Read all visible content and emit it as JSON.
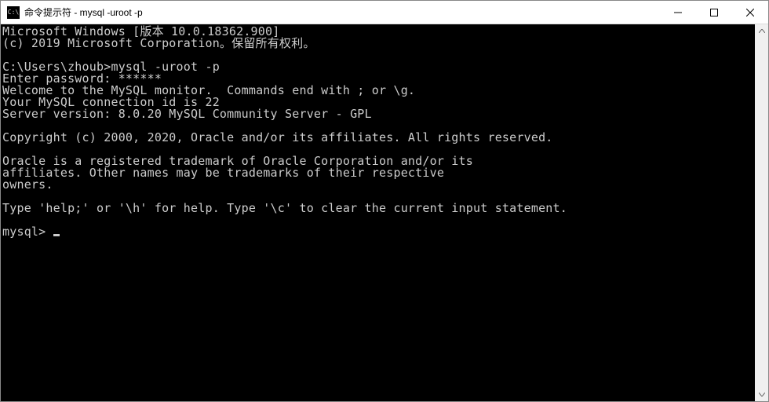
{
  "window": {
    "title": "命令提示符 - mysql  -uroot -p",
    "icon_label": "C:\\"
  },
  "terminal": {
    "line1": "Microsoft Windows [版本 10.0.18362.900]",
    "line2": "(c) 2019 Microsoft Corporation。保留所有权利。",
    "blank1": "",
    "line3": "C:\\Users\\zhoub>mysql -uroot -p",
    "line4": "Enter password: ******",
    "line5": "Welcome to the MySQL monitor.  Commands end with ; or \\g.",
    "line6": "Your MySQL connection id is 22",
    "line7": "Server version: 8.0.20 MySQL Community Server - GPL",
    "blank2": "",
    "line8": "Copyright (c) 2000, 2020, Oracle and/or its affiliates. All rights reserved.",
    "blank3": "",
    "line9": "Oracle is a registered trademark of Oracle Corporation and/or its",
    "line10": "affiliates. Other names may be trademarks of their respective",
    "line11": "owners.",
    "blank4": "",
    "line12": "Type 'help;' or '\\h' for help. Type '\\c' to clear the current input statement.",
    "blank5": "",
    "prompt": "mysql> "
  }
}
